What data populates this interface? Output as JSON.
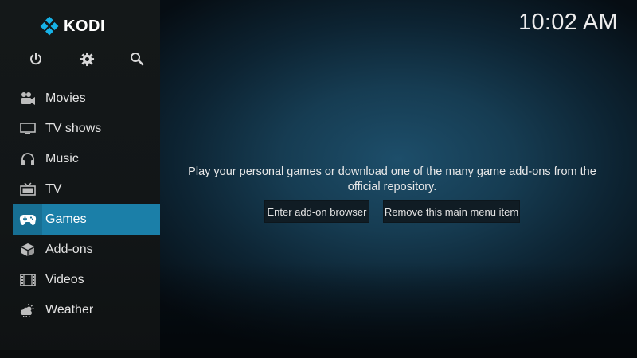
{
  "app": {
    "name": "KODI",
    "logo_icon": "kodi-logo-icon"
  },
  "clock": {
    "time": "10:02 AM"
  },
  "top_icons": [
    {
      "name": "power-icon"
    },
    {
      "name": "gear-icon"
    },
    {
      "name": "search-icon"
    }
  ],
  "menu": {
    "active": "Games",
    "items": [
      {
        "label": "Movies",
        "icon": "movie-camera-icon"
      },
      {
        "label": "TV shows",
        "icon": "monitor-icon"
      },
      {
        "label": "Music",
        "icon": "headphones-icon"
      },
      {
        "label": "TV",
        "icon": "tv-icon"
      },
      {
        "label": "Games",
        "icon": "gamepad-icon"
      },
      {
        "label": "Add-ons",
        "icon": "addons-box-icon"
      },
      {
        "label": "Videos",
        "icon": "film-strip-icon"
      },
      {
        "label": "Weather",
        "icon": "weather-cloud-icon"
      }
    ]
  },
  "main": {
    "message": "Play your personal games or download one of the many game add-ons from the official repository.",
    "buttons": {
      "enter_addon_browser": "Enter add-on browser",
      "remove_menu_item": "Remove this main menu item"
    }
  },
  "colors": {
    "accent": "#1b7fa8",
    "accent_dark": "#176f93",
    "sidebar_bg": "#141819",
    "logo_blue": "#17b2e7"
  }
}
